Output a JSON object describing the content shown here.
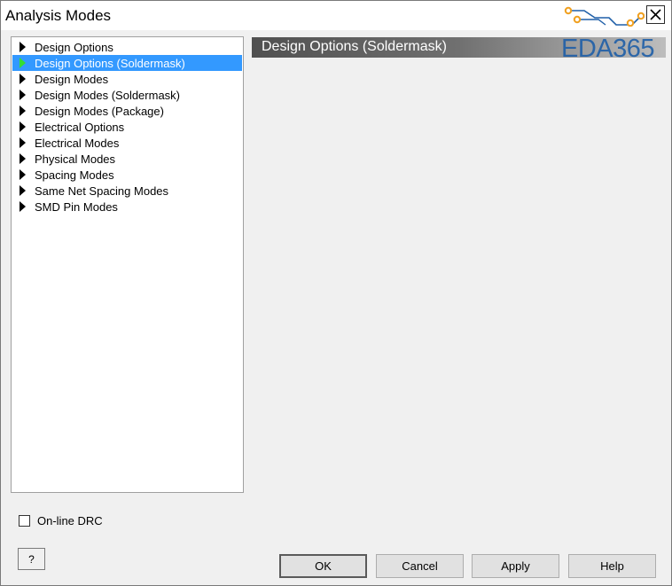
{
  "window": {
    "title": "Analysis Modes",
    "close_glyph": "✕"
  },
  "tree": {
    "items": [
      {
        "label": "Design Options",
        "selected": false
      },
      {
        "label": "Design Options (Soldermask)",
        "selected": true
      },
      {
        "label": "Design Modes",
        "selected": false
      },
      {
        "label": "Design Modes (Soldermask)",
        "selected": false
      },
      {
        "label": "Design Modes (Package)",
        "selected": false
      },
      {
        "label": "Electrical Options",
        "selected": false
      },
      {
        "label": "Electrical Modes",
        "selected": false
      },
      {
        "label": "Physical Modes",
        "selected": false
      },
      {
        "label": "Spacing Modes",
        "selected": false
      },
      {
        "label": "Same Net Spacing Modes",
        "selected": false
      },
      {
        "label": "SMD Pin Modes",
        "selected": false
      }
    ]
  },
  "panel": {
    "title": "Design Options (Soldermask)",
    "watermark": "EDA365"
  },
  "options": {
    "online_drc_label": "On-line DRC",
    "online_drc_checked": false
  },
  "buttons": {
    "help_q": "?",
    "ok": "OK",
    "cancel": "Cancel",
    "apply": "Apply",
    "help": "Help"
  },
  "colors": {
    "selection": "#3399ff",
    "selected_arrow": "#33dd33",
    "watermark": "#1f5fa8",
    "header_dark": "#505050",
    "header_light": "#bdbdbd"
  }
}
